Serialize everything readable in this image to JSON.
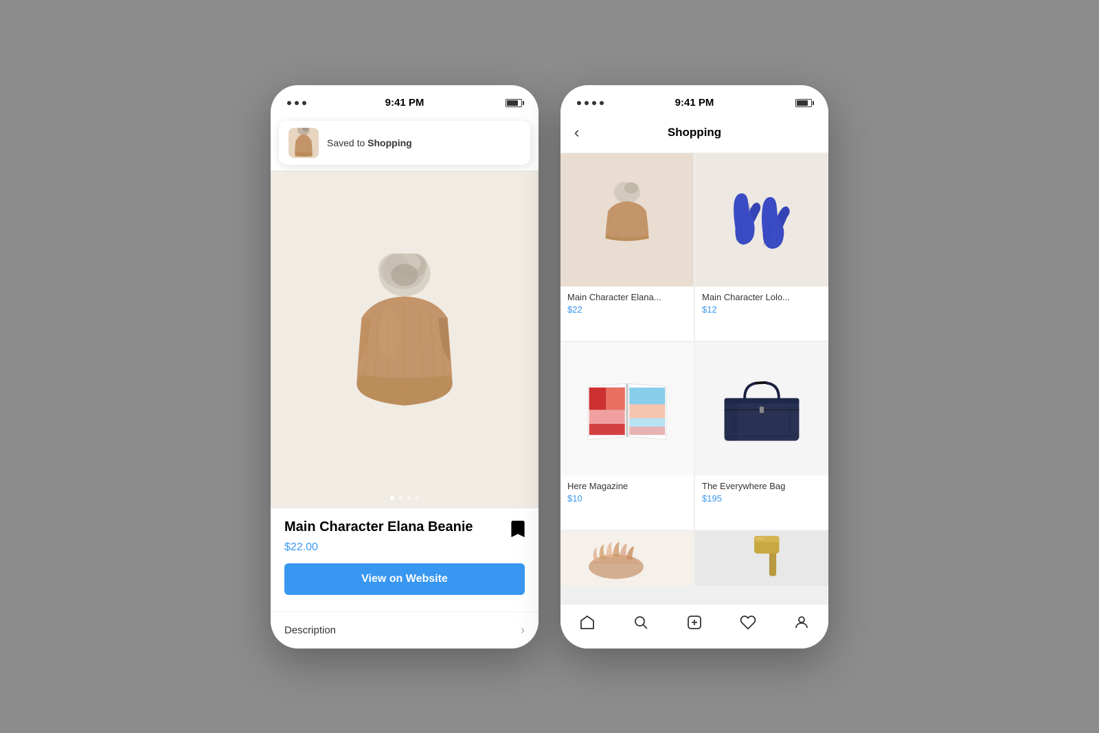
{
  "left_phone": {
    "status_bar": {
      "dots": 3,
      "time": "9:41 PM"
    },
    "notification": {
      "text_pre": "Saved to ",
      "text_bold": "Shopping"
    },
    "product": {
      "name": "Main Character Elana Beanie",
      "price": "$22.00",
      "view_btn": "View on Website",
      "description_label": "Description",
      "bookmark_label": "bookmark"
    },
    "dots": [
      "active",
      "",
      "",
      ""
    ]
  },
  "right_phone": {
    "status_bar": {
      "dots": 4,
      "time": "9:41 PM"
    },
    "header": {
      "back_label": "‹",
      "title": "Shopping"
    },
    "grid_items": [
      {
        "name": "Main Character Elana...",
        "price": "$22",
        "bg": "beige",
        "image_type": "beanie_brown"
      },
      {
        "name": "Main Character Lolo...",
        "price": "$12",
        "bg": "cream",
        "image_type": "mittens_blue"
      },
      {
        "name": "Here Magazine",
        "price": "$10",
        "bg": "white",
        "image_type": "magazine"
      },
      {
        "name": "The Everywhere Bag",
        "price": "$195",
        "bg": "white",
        "image_type": "bag_navy"
      },
      {
        "name": "",
        "price": "",
        "bg": "white",
        "image_type": "shoes_feather"
      },
      {
        "name": "",
        "price": "",
        "bg": "gray",
        "image_type": "hammer_gold"
      }
    ],
    "bottom_nav": {
      "items": [
        "home",
        "search",
        "add",
        "heart",
        "profile"
      ]
    }
  }
}
